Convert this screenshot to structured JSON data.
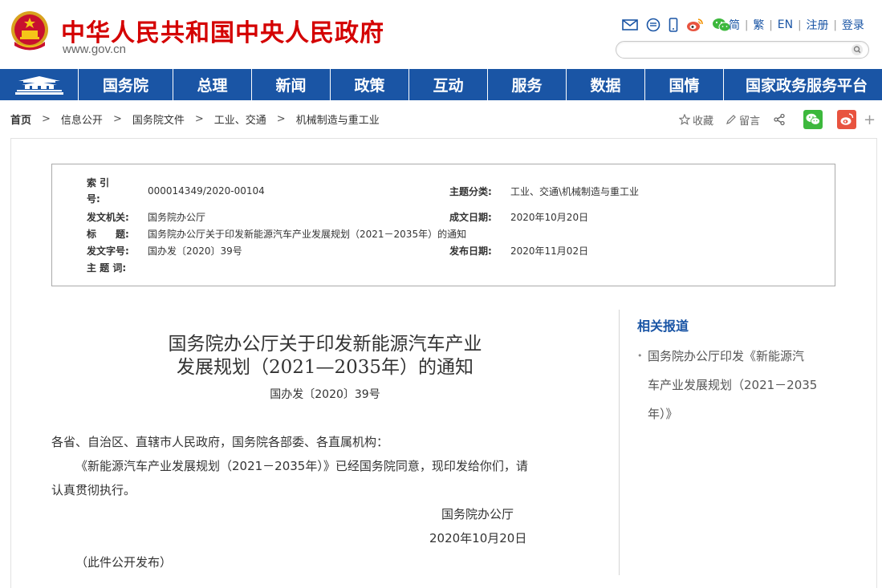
{
  "header": {
    "site_title": "中华人民共和国中央人民政府",
    "site_url": "www.gov.cn",
    "lang_links": [
      "简",
      "繁",
      "EN",
      "注册",
      "登录"
    ],
    "icons": [
      "mail-icon",
      "message-icon",
      "mobile-icon",
      "weibo-icon",
      "wechat-icon"
    ],
    "search_placeholder": ""
  },
  "nav": {
    "items": [
      "国务院",
      "总理",
      "新闻",
      "政策",
      "互动",
      "服务",
      "数据",
      "国情",
      "国家政务服务平台"
    ]
  },
  "breadcrumb": [
    "首页",
    "信息公开",
    "国务院文件",
    "工业、交通",
    "机械制造与重工业"
  ],
  "share": {
    "favorite_label": "收藏",
    "comment_label": "留言",
    "plus_label": "+"
  },
  "info": {
    "index_label_1": "索 引",
    "index_label_2": "号:",
    "index_value": "000014349/2020-00104",
    "topic_label": "主题分类:",
    "topic_value": "工业、交通\\机械制造与重工业",
    "issuer_label": "发文机关:",
    "issuer_value": "国务院办公厅",
    "created_label": "成文日期:",
    "created_value": "2020年10月20日",
    "title_label": "标　　题:",
    "title_value": "国务院办公厅关于印发新能源汽车产业发展规划（2021－2035年）的通知",
    "docno_label": "发文字号:",
    "docno_value": "国办发〔2020〕39号",
    "published_label": "发布日期:",
    "published_value": "2020年11月02日",
    "keywords_label": "主 题 词:"
  },
  "document": {
    "title_line1": "国务院办公厅关于印发新能源汽车产业",
    "title_line2": "发展规划（2021—2035年）的通知",
    "number": "国办发〔2020〕39号",
    "salutation": "各省、自治区、直辖市人民政府，国务院各部委、各直属机构：",
    "para1_line1": "《新能源汽车产业发展规划（2021－2035年）》已经国务院同意，现印发给你们，请",
    "para1_line2": "认真贯彻执行。",
    "signature": "国务院办公厅",
    "date": "2020年10月20日",
    "note": "（此件公开发布）"
  },
  "related": {
    "title": "相关报道",
    "items": [
      {
        "line1": "国务院办公厅印发《新能源汽",
        "line2": "车产业发展规划（2021－2035",
        "line3": "年）》"
      }
    ]
  },
  "colors": {
    "brand_red": "#d40000",
    "nav_blue": "#1a55a5",
    "wechat_green": "#3db83d",
    "weibo_red": "#e8533f"
  }
}
